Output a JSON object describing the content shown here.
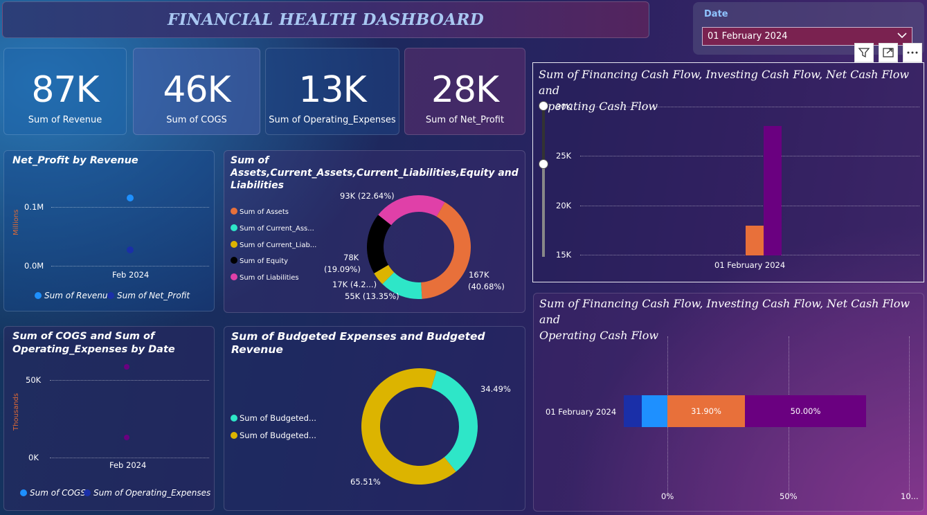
{
  "title": "FINANCIAL HEALTH DASHBOARD",
  "slicer": {
    "label": "Date",
    "value": "01 February 2024"
  },
  "kpis": [
    {
      "value": "87K",
      "label": "Sum of Revenue"
    },
    {
      "value": "46K",
      "label": "Sum of COGS"
    },
    {
      "value": "13K",
      "label": "Sum of Operating_Expenses"
    },
    {
      "value": "28K",
      "label": "Sum of Net_Profit"
    }
  ],
  "colors": {
    "revenue": "#1e90ff",
    "net_profit": "#1a2fa8",
    "assets": "#e8703a",
    "current_assets": "#2ee6c8",
    "current_liabilities": "#dcb400",
    "equity": "#000000",
    "liabilities": "#e040a8",
    "purple": "#6a0080",
    "dark_blue": "#1a2fa8"
  },
  "net_profit_chart": {
    "title": "Net_Profit by Revenue",
    "y_axis_label": "Millions",
    "y_ticks": [
      "0.1M",
      "0.0M"
    ],
    "x_tick": "Feb 2024",
    "legend": [
      "Sum of Revenue",
      "Sum of Net_Profit"
    ]
  },
  "cogs_chart": {
    "title": "Sum of COGS and Sum of Operating_Expenses by Date",
    "title_line1": "Sum of COGS and Sum of",
    "title_line2": "Operating_Expenses by Date",
    "y_axis_label": "Thousands",
    "y_ticks": [
      "50K",
      "0K"
    ],
    "x_tick": "Feb 2024",
    "legend": [
      "Sum of COGS",
      "Sum of Operating_Expenses"
    ]
  },
  "balance_chart": {
    "title": "Sum of Assets,Current_Assets,Current_Liabilities,Equity and Liabilities",
    "legend": [
      "Sum of Assets",
      "Sum of Current_Ass...",
      "Sum of Current_Liab...",
      "Sum of Equity",
      "Sum of Liabilities"
    ],
    "labels": {
      "assets_a": "167K",
      "assets_b": "(40.68%)",
      "current_assets": "55K (13.35%)",
      "current_liab": "17K (4.2...)",
      "equity_a": "78K",
      "equity_b": "(19.09%)",
      "liabilities": "93K (22.64%)"
    }
  },
  "budget_chart": {
    "title": "Sum of Budgeted Expenses and Budgeted Revenue",
    "legend": [
      "Sum of Budgeted...",
      "Sum of Budgeted..."
    ],
    "labels": {
      "teal": "34.49%",
      "yellow": "65.51%"
    }
  },
  "cashflow_col_chart": {
    "title_line1": "Sum of Financing Cash Flow, Investing Cash Flow, Net Cash Flow and",
    "title_line2": "Operating Cash Flow",
    "y_ticks": [
      "30K",
      "25K",
      "20K",
      "15K"
    ],
    "x_tick": "01 February 2024"
  },
  "cashflow_bar_chart": {
    "title_line1": "Sum of Financing Cash Flow, Investing Cash Flow, Net Cash Flow and",
    "title_line2": "Operating Cash Flow",
    "category": "01 February 2024",
    "seg_labels": {
      "orange": "31.90%",
      "purple": "50.00%"
    },
    "x_ticks": [
      "0%",
      "50%",
      "10..."
    ]
  },
  "chart_data": [
    {
      "type": "donut",
      "title": "Sum of Assets,Current_Assets,Current_Liabilities,Equity and Liabilities",
      "categories": [
        "Sum of Assets",
        "Sum of Current_Assets",
        "Sum of Current_Liabilities",
        "Sum of Equity",
        "Sum of Liabilities"
      ],
      "values": [
        167000,
        55000,
        17000,
        78000,
        93000
      ],
      "percents": [
        40.68,
        13.35,
        4.2,
        19.09,
        22.64
      ]
    },
    {
      "type": "donut",
      "title": "Sum of Budgeted Expenses and Budgeted Revenue",
      "categories": [
        "Sum of Budgeted...",
        "Sum of Budgeted..."
      ],
      "percents": [
        34.49,
        65.51
      ]
    },
    {
      "type": "bar",
      "title": "Sum of Financing Cash Flow, Investing Cash Flow, Net Cash Flow and Operating Cash Flow",
      "categories": [
        "01 February 2024"
      ],
      "ylim": [
        15000,
        30000
      ],
      "series": [
        {
          "values": [
            18000
          ]
        },
        {
          "values": [
            28000
          ]
        }
      ]
    },
    {
      "type": "bar",
      "orientation": "horizontal-100%-stacked",
      "title": "Sum of Financing Cash Flow, Investing Cash Flow, Net Cash Flow and Operating Cash Flow",
      "categories": [
        "01 February 2024"
      ],
      "series": [
        {
          "values": [
            7.5
          ]
        },
        {
          "values": [
            10.6
          ]
        },
        {
          "values": [
            31.9
          ]
        },
        {
          "values": [
            50.0
          ]
        }
      ]
    },
    {
      "type": "scatter",
      "title": "Net_Profit by Revenue",
      "x": [
        "Feb 2024"
      ],
      "series": [
        {
          "name": "Sum of Revenue",
          "values": [
            0.087
          ]
        },
        {
          "name": "Sum of Net_Profit",
          "values": [
            0.028
          ]
        }
      ],
      "ylim": [
        0,
        0.1
      ]
    },
    {
      "type": "scatter",
      "title": "Sum of COGS and Sum of Operating_Expenses by Date",
      "x": [
        "Feb 2024"
      ],
      "series": [
        {
          "name": "Sum of COGS",
          "values": [
            46
          ]
        },
        {
          "name": "Sum of Operating_Expenses",
          "values": [
            13
          ]
        }
      ],
      "ylim": [
        0,
        50
      ]
    }
  ]
}
